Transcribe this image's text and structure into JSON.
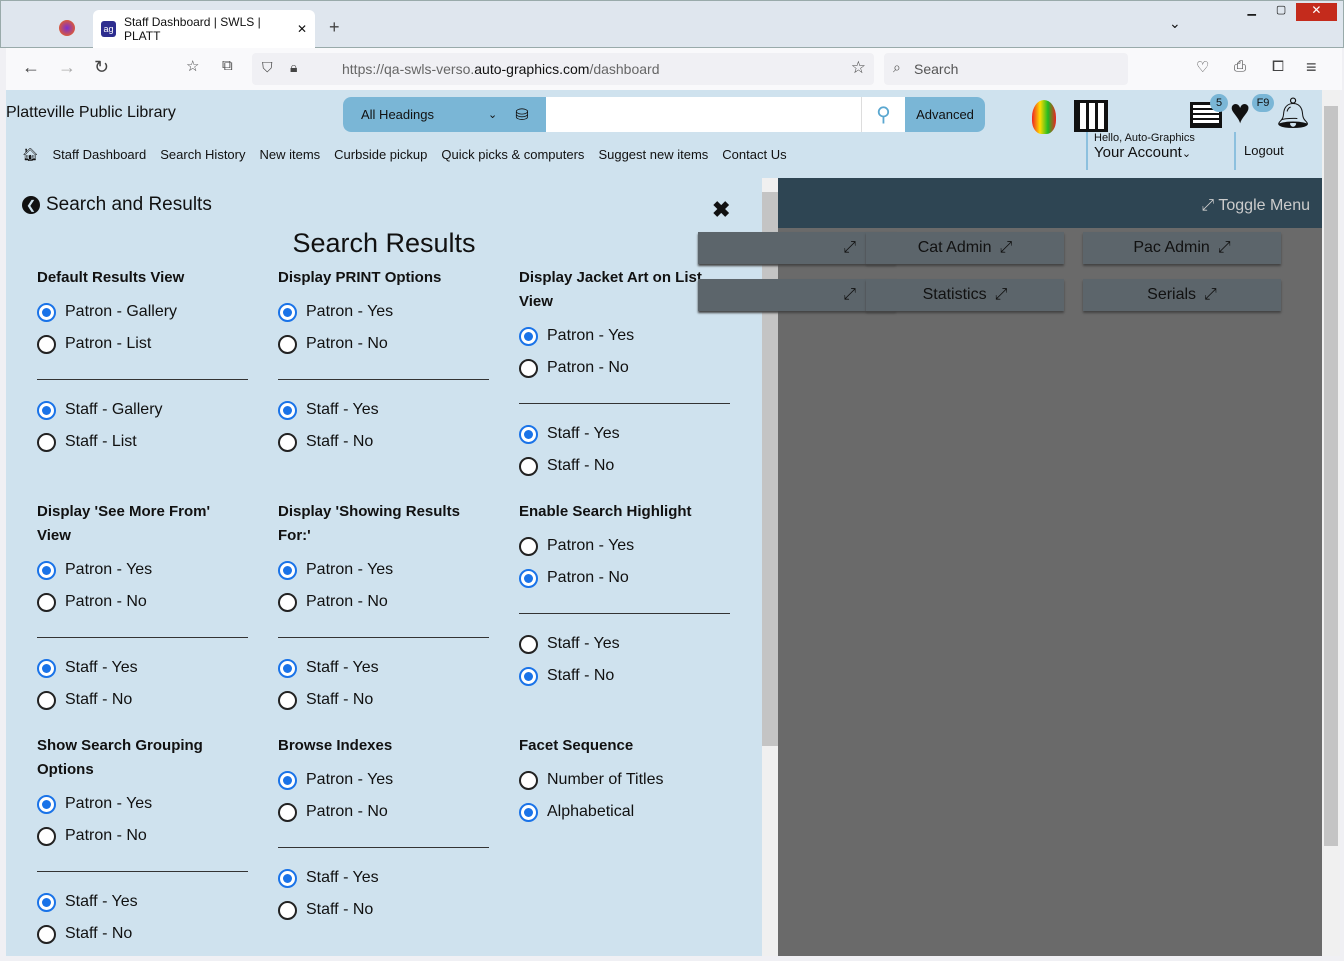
{
  "browser": {
    "tab_title": "Staff Dashboard | SWLS | PLATT",
    "url_prefix": "https://qa-swls-verso.",
    "url_domain": "auto-graphics.com",
    "url_path": "/dashboard",
    "search_placeholder": "Search"
  },
  "header": {
    "library": "Platteville Public Library",
    "search_scope": "All Headings",
    "advanced": "Advanced",
    "list_count": "5",
    "favorites_badge": "F9",
    "greeting": "Hello, Auto-Graphics",
    "account": "Your Account",
    "logout": "Logout",
    "menu": [
      "Staff Dashboard",
      "Search History",
      "New items",
      "Curbside pickup",
      "Quick picks & computers",
      "Suggest new items",
      "Contact Us"
    ]
  },
  "panel": {
    "back_label": "Search and Results",
    "title": "Search Results",
    "sections": [
      {
        "title": "Default Results View",
        "groups": [
          [
            [
              "Patron - Gallery",
              true
            ],
            [
              "Patron - List",
              false
            ]
          ],
          [
            [
              "Staff - Gallery",
              true
            ],
            [
              "Staff - List",
              false
            ]
          ]
        ]
      },
      {
        "title": "Display PRINT Options",
        "groups": [
          [
            [
              "Patron - Yes",
              true
            ],
            [
              "Patron - No",
              false
            ]
          ],
          [
            [
              "Staff - Yes",
              true
            ],
            [
              "Staff - No",
              false
            ]
          ]
        ]
      },
      {
        "title": "Display Jacket Art on List View",
        "groups": [
          [
            [
              "Patron - Yes",
              true
            ],
            [
              "Patron - No",
              false
            ]
          ],
          [
            [
              "Staff - Yes",
              true
            ],
            [
              "Staff - No",
              false
            ]
          ]
        ]
      },
      {
        "title": "Display 'See More From' View",
        "groups": [
          [
            [
              "Patron - Yes",
              true
            ],
            [
              "Patron - No",
              false
            ]
          ],
          [
            [
              "Staff - Yes",
              true
            ],
            [
              "Staff - No",
              false
            ]
          ]
        ]
      },
      {
        "title": "Display 'Showing Results For:'",
        "groups": [
          [
            [
              "Patron - Yes",
              true
            ],
            [
              "Patron - No",
              false
            ]
          ],
          [
            [
              "Staff - Yes",
              true
            ],
            [
              "Staff - No",
              false
            ]
          ]
        ]
      },
      {
        "title": "Enable Search Highlight",
        "groups": [
          [
            [
              "Patron - Yes",
              false
            ],
            [
              "Patron - No",
              true
            ]
          ],
          [
            [
              "Staff - Yes",
              false
            ],
            [
              "Staff - No",
              true
            ]
          ]
        ]
      },
      {
        "title": "Show Search Grouping Options",
        "groups": [
          [
            [
              "Patron - Yes",
              true
            ],
            [
              "Patron - No",
              false
            ]
          ],
          [
            [
              "Staff - Yes",
              true
            ],
            [
              "Staff - No",
              false
            ]
          ]
        ]
      },
      {
        "title": "Browse Indexes",
        "groups": [
          [
            [
              "Patron - Yes",
              true
            ],
            [
              "Patron - No",
              false
            ]
          ],
          [
            [
              "Staff - Yes",
              true
            ],
            [
              "Staff - No",
              false
            ]
          ]
        ]
      },
      {
        "title": "Facet Sequence",
        "groups": [
          [
            [
              "Number of Titles",
              false
            ],
            [
              "Alphabetical",
              true
            ]
          ]
        ]
      }
    ]
  },
  "overlay": {
    "toggle": "Toggle Menu",
    "tiles": [
      "",
      "Cat Admin",
      "Pac Admin",
      "",
      "Statistics",
      "Serials"
    ]
  }
}
